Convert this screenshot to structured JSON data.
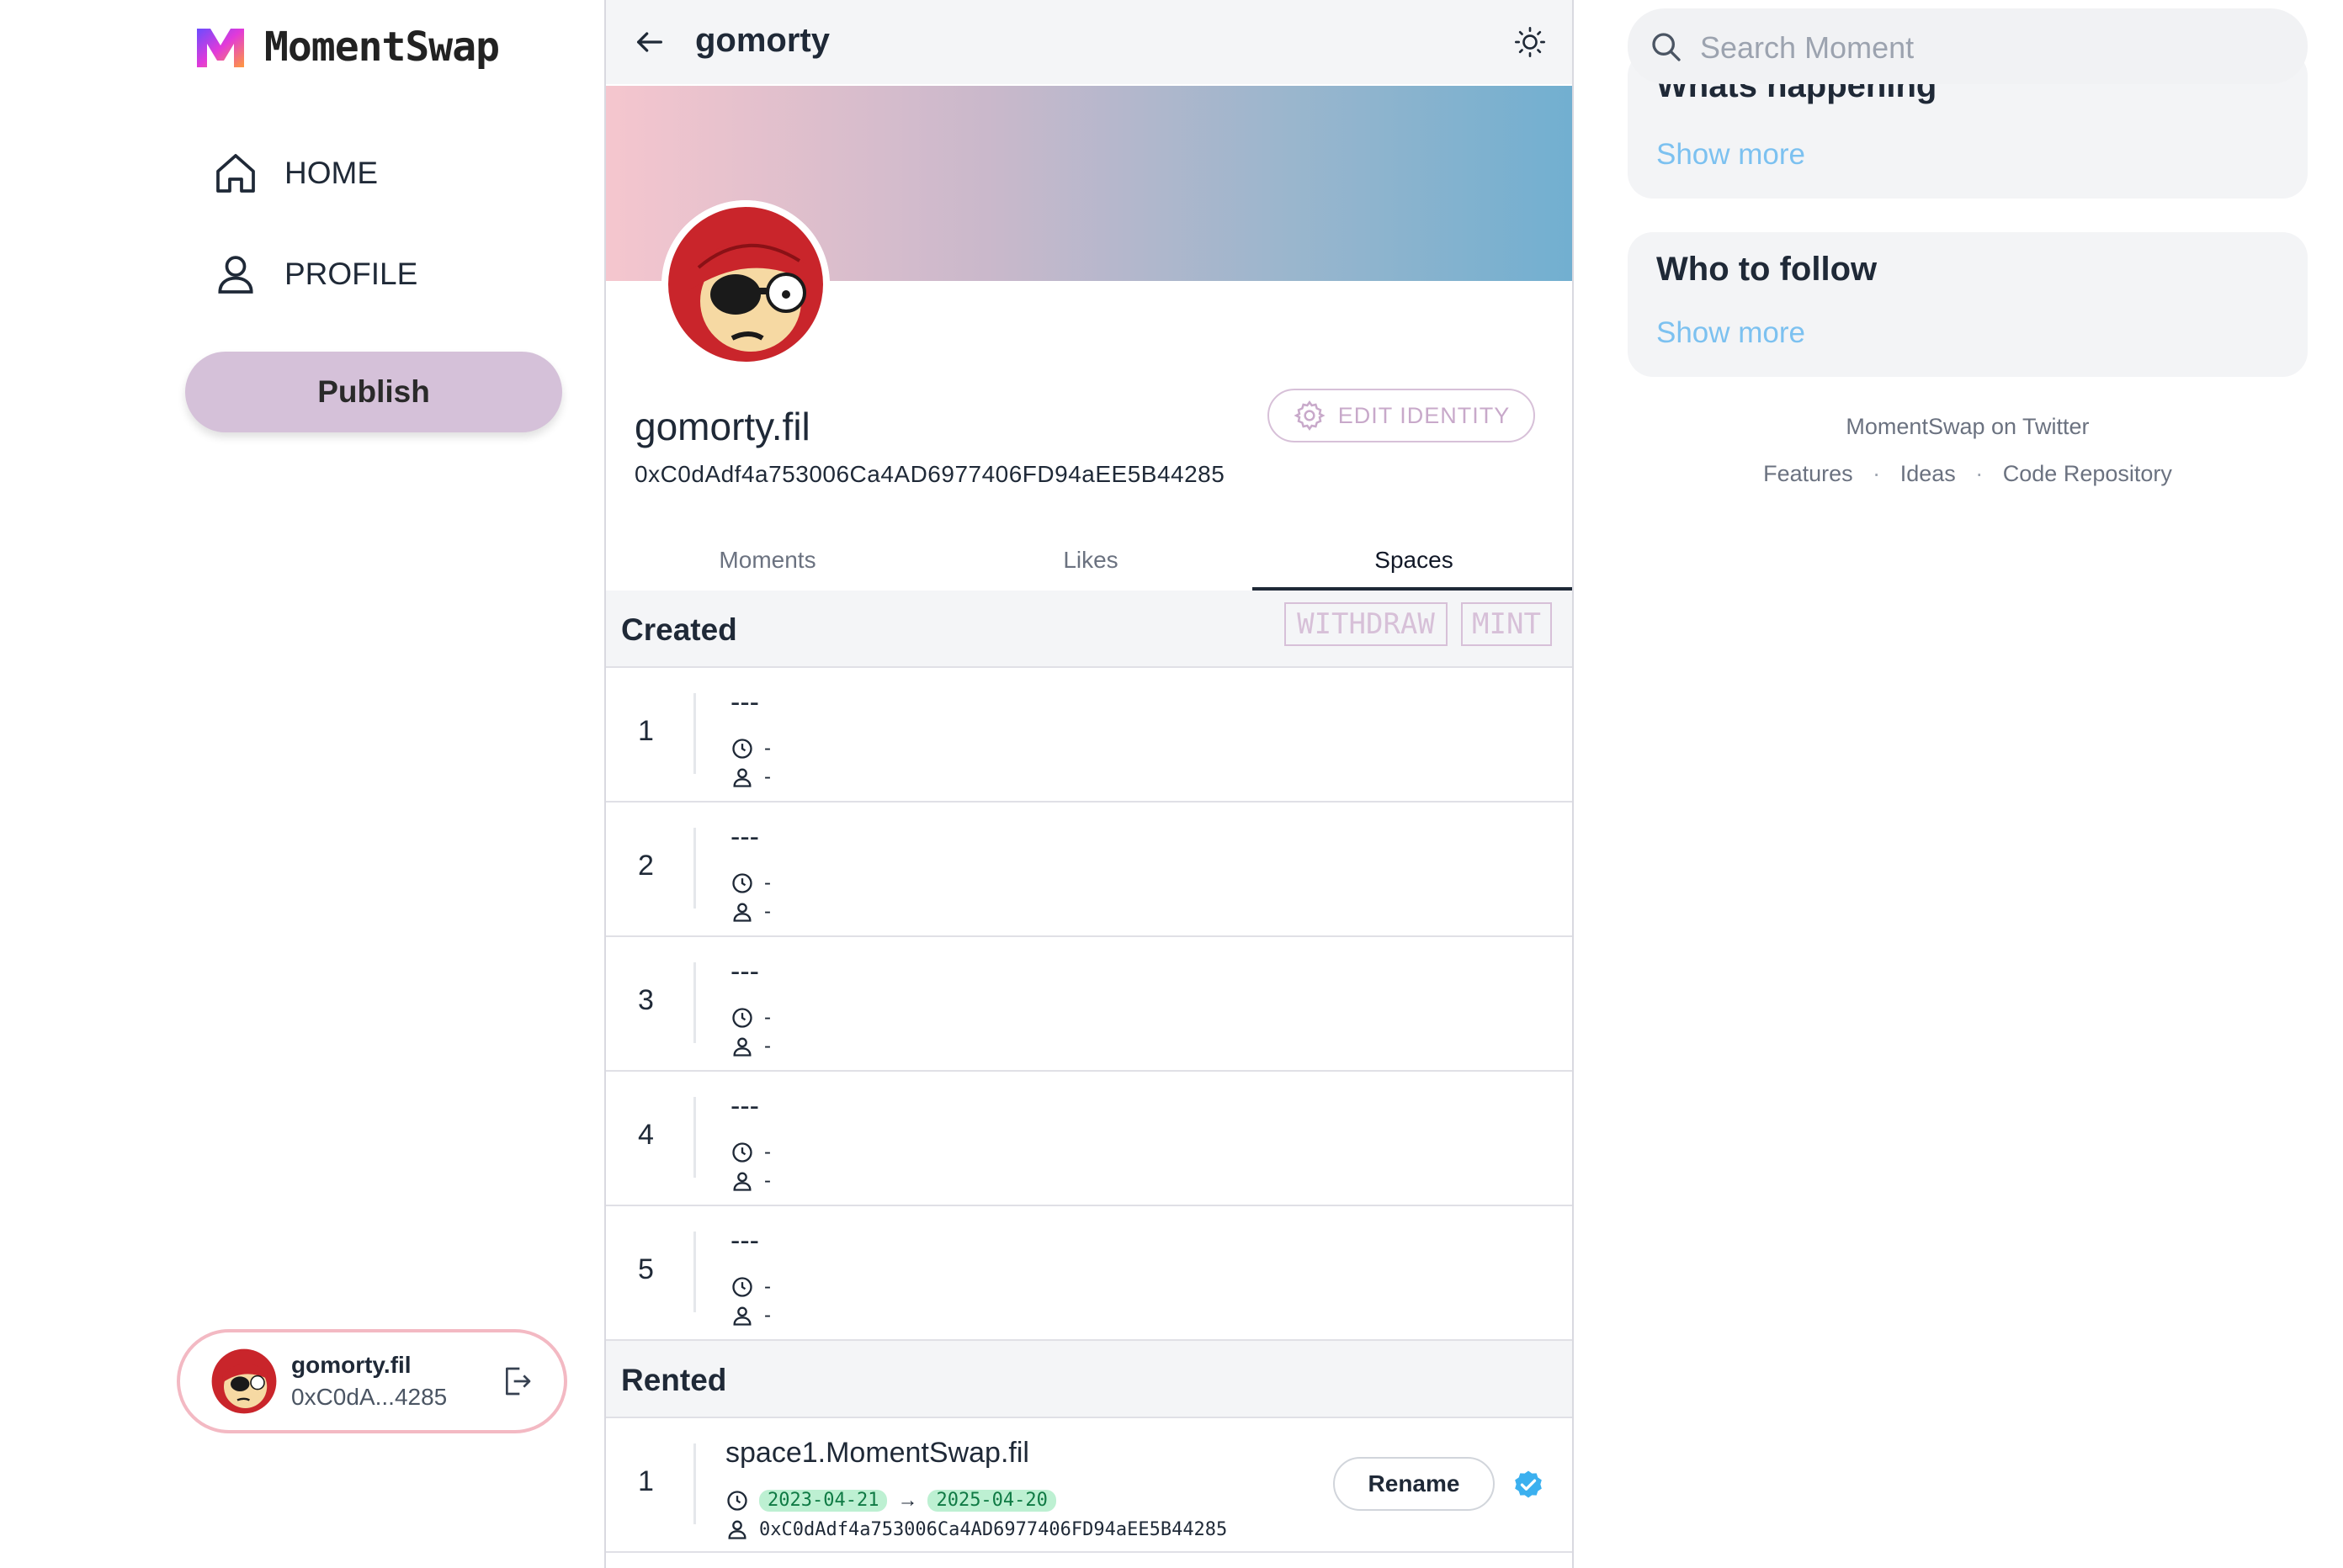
{
  "app": {
    "name": "MomentSwap"
  },
  "nav": {
    "home": "HOME",
    "profile": "PROFILE",
    "publish": "Publish"
  },
  "current_user": {
    "name": "gomorty.fil",
    "short_address": "0xC0dA...4285"
  },
  "header": {
    "title": "gomorty"
  },
  "profile": {
    "name": "gomorty.fil",
    "address": "0xC0dAdf4a753006Ca4AD6977406FD94aEE5B44285",
    "edit_label": "EDIT IDENTITY"
  },
  "tabs": [
    {
      "label": "Moments",
      "active": false
    },
    {
      "label": "Likes",
      "active": false
    },
    {
      "label": "Spaces",
      "active": true
    }
  ],
  "created": {
    "title": "Created",
    "withdraw_label": "WITHDRAW",
    "mint_label": "MINT",
    "rows": [
      {
        "index": "1",
        "name": "---",
        "time": "-",
        "owner": "-"
      },
      {
        "index": "2",
        "name": "---",
        "time": "-",
        "owner": "-"
      },
      {
        "index": "3",
        "name": "---",
        "time": "-",
        "owner": "-"
      },
      {
        "index": "4",
        "name": "---",
        "time": "-",
        "owner": "-"
      },
      {
        "index": "5",
        "name": "---",
        "time": "-",
        "owner": "-"
      }
    ]
  },
  "rented": {
    "title": "Rented",
    "rows": [
      {
        "index": "1",
        "name": "space1.MomentSwap.fil",
        "start": "2023-04-21",
        "arrow": "→",
        "end": "2025-04-20",
        "owner": "0xC0dAdf4a753006Ca4AD6977406FD94aEE5B44285",
        "rename_label": "Rename"
      }
    ]
  },
  "search": {
    "placeholder": "Search Moment"
  },
  "whats_happening": {
    "title": "Whats happening",
    "more": "Show more"
  },
  "who_to_follow": {
    "title": "Who to follow",
    "more": "Show more"
  },
  "footer": {
    "twitter": "MomentSwap on Twitter",
    "links": [
      "Features",
      "Ideas",
      "Code Repository"
    ],
    "separator": "·"
  },
  "colors": {
    "accent": "#d5c1d9",
    "banner_start": "#f5c6ce",
    "banner_end": "#71afd0",
    "link": "#7cc1f0",
    "badge_bg": "#bdf0d2",
    "verified": "#3bb0ef"
  },
  "icons": [
    "logo-icon",
    "home-icon",
    "user-icon",
    "logout-icon",
    "back-arrow-icon",
    "sun-icon",
    "gear-icon",
    "clock-icon",
    "person-icon",
    "verified-icon",
    "search-icon"
  ]
}
